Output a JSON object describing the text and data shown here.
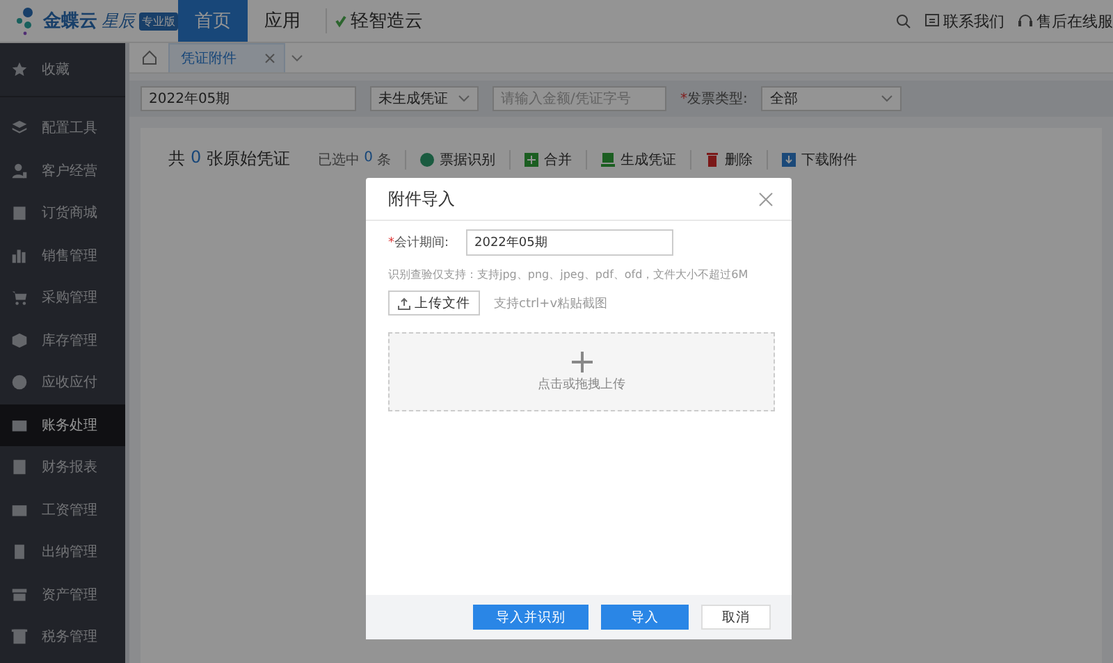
{
  "header": {
    "logo": {
      "name": "金蝶云",
      "sub": "星辰",
      "badge": "专业版"
    },
    "nav": [
      {
        "label": "首页",
        "selected": true
      },
      {
        "label": "应用",
        "selected": false
      }
    ],
    "brand_link": "轻智造云",
    "contact": "联系我们",
    "service": "售后在线服"
  },
  "sidebar": {
    "items": [
      {
        "label": "收藏",
        "selected": false
      },
      {
        "label": "配置工具",
        "selected": false
      },
      {
        "label": "客户经营",
        "selected": false
      },
      {
        "label": "订货商城",
        "selected": false
      },
      {
        "label": "销售管理",
        "selected": false
      },
      {
        "label": "采购管理",
        "selected": false
      },
      {
        "label": "库存管理",
        "selected": false
      },
      {
        "label": "应收应付",
        "selected": false
      },
      {
        "label": "账务处理",
        "selected": true
      },
      {
        "label": "财务报表",
        "selected": false
      },
      {
        "label": "工资管理",
        "selected": false
      },
      {
        "label": "出纳管理",
        "selected": false
      },
      {
        "label": "资产管理",
        "selected": false
      },
      {
        "label": "税务管理",
        "selected": false
      }
    ]
  },
  "tabs": [
    {
      "label": "凭证附件",
      "selected": true
    }
  ],
  "filters": {
    "period": "2022年05期",
    "status": "未生成凭证",
    "search_placeholder": "请输入金额/凭证字号",
    "required_mark": "*",
    "invoice_type_label": "发票类型:",
    "invoice_type": "全部"
  },
  "summary": {
    "prefix": "共",
    "count": "0",
    "suffix": "张原始凭证",
    "selected_prefix": "已选中",
    "selected_count": "0",
    "selected_suffix": "条"
  },
  "actions": [
    {
      "label": "票据识别"
    },
    {
      "label": "合并"
    },
    {
      "label": "生成凭证"
    },
    {
      "label": "删除"
    },
    {
      "label": "下载附件"
    }
  ],
  "dialog": {
    "title": "附件导入",
    "required_mark": "*",
    "period_label": "会计期间:",
    "period_value": "2022年05期",
    "hint": "识别查验仅支持：支持jpg、png、jpeg、pdf、ofd，文件大小不超过6M",
    "upload_button": "上传文件",
    "paste_hint": "支持ctrl+v粘贴截图",
    "drop_text": "点击或拖拽上传",
    "buttons": [
      {
        "label": "导入并识别",
        "primary": true
      },
      {
        "label": "导入",
        "primary": true
      },
      {
        "label": "取消",
        "primary": false
      }
    ]
  }
}
